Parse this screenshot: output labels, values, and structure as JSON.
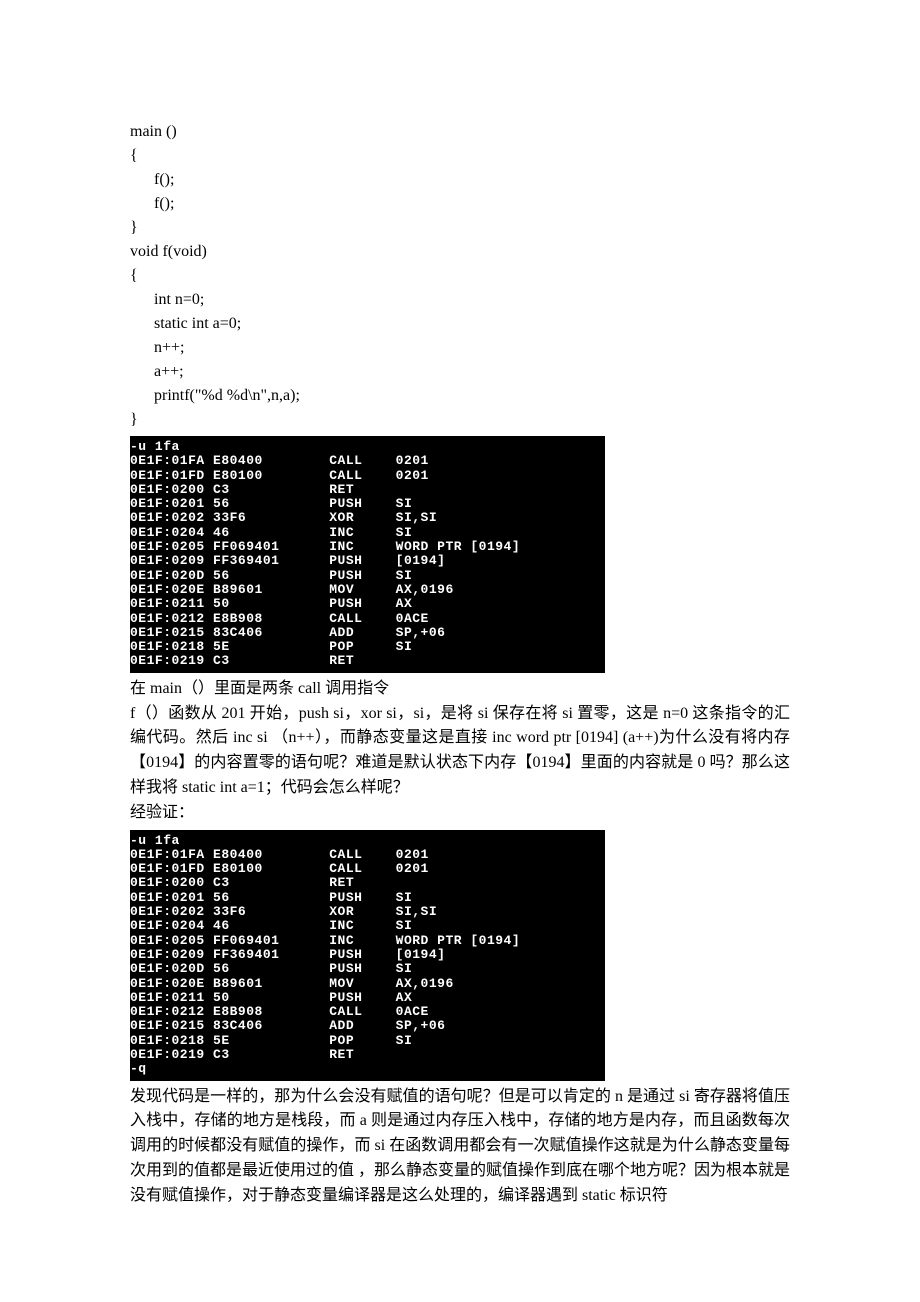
{
  "code": {
    "l1": "main ()",
    "l2": "{",
    "l3": "      f();",
    "l4": "      f();",
    "l5": "}",
    "l6": "void f(void)",
    "l7": "{",
    "l8": "      int n=0;",
    "l9": "      static int a=0;",
    "l10": "      n++;",
    "l11": "      a++;",
    "l12": "      printf(\"%d %d\\n\",n,a);",
    "l13": "}"
  },
  "term1": "-u 1fa\n0E1F:01FA E80400        CALL    0201\n0E1F:01FD E80100        CALL    0201\n0E1F:0200 C3            RET\n0E1F:0201 56            PUSH    SI\n0E1F:0202 33F6          XOR     SI,SI\n0E1F:0204 46            INC     SI\n0E1F:0205 FF069401      INC     WORD PTR [0194]\n0E1F:0209 FF369401      PUSH    [0194]\n0E1F:020D 56            PUSH    SI\n0E1F:020E B89601        MOV     AX,0196\n0E1F:0211 50            PUSH    AX\n0E1F:0212 E8B908        CALL    0ACE\n0E1F:0215 83C406        ADD     SP,+06\n0E1F:0218 5E            POP     SI\n0E1F:0219 C3            RET",
  "para1": "在 main（）里面是两条 call 调用指令",
  "para2": "f（）函数从 201 开始，push si，xor si，si，是将 si 保存在将 si 置零，这是 n=0 这条指令的汇编代码。然后 inc si （n++），而静态变量这是直接 inc word ptr [0194] (a++)为什么没有将内存【0194】的内容置零的语句呢？难道是默认状态下内存【0194】里面的内容就是 0 吗？那么这样我将 static int a=1；代码会怎么样呢？",
  "para3": "经验证：",
  "term2": "-u 1fa\n0E1F:01FA E80400        CALL    0201\n0E1F:01FD E80100        CALL    0201\n0E1F:0200 C3            RET\n0E1F:0201 56            PUSH    SI\n0E1F:0202 33F6          XOR     SI,SI\n0E1F:0204 46            INC     SI\n0E1F:0205 FF069401      INC     WORD PTR [0194]\n0E1F:0209 FF369401      PUSH    [0194]\n0E1F:020D 56            PUSH    SI\n0E1F:020E B89601        MOV     AX,0196\n0E1F:0211 50            PUSH    AX\n0E1F:0212 E8B908        CALL    0ACE\n0E1F:0215 83C406        ADD     SP,+06\n0E1F:0218 5E            POP     SI\n0E1F:0219 C3            RET\n-q",
  "para4": "发现代码是一样的，那为什么会没有赋值的语句呢？但是可以肯定的 n 是通过 si 寄存器将值压入栈中，存储的地方是栈段，而 a 则是通过内存压入栈中，存储的地方是内存，而且函数每次调用的时候都没有赋值的操作，而 si 在函数调用都会有一次赋值操作这就是为什么静态变量每次用到的值都是最近使用过的值 ，那么静态变量的赋值操作到底在哪个地方呢？因为根本就是没有赋值操作，对于静态变量编译器是这么处理的，编译器遇到 static 标识符"
}
